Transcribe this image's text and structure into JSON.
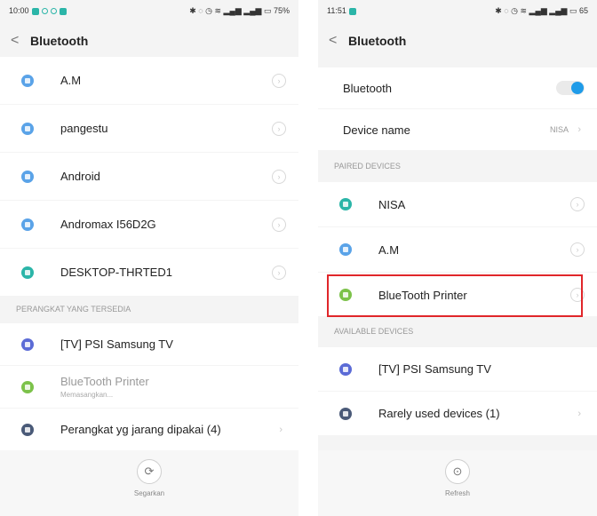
{
  "left": {
    "status": {
      "time": "10:00",
      "battery": "75%"
    },
    "title": "Bluetooth",
    "paired": [
      {
        "label": "A.M",
        "color": "#5aa3e8"
      },
      {
        "label": "pangestu",
        "color": "#5aa3e8"
      },
      {
        "label": "Android",
        "color": "#5aa3e8"
      },
      {
        "label": "Andromax I56D2G",
        "color": "#5aa3e8"
      },
      {
        "label": "DESKTOP-THRTED1",
        "color": "#2bb5a8"
      }
    ],
    "section_available": "PERANGKAT YANG TERSEDIA",
    "available": [
      {
        "label": "[TV] PSI Samsung TV",
        "color": "#5b6bd6"
      },
      {
        "label": "BlueTooth Printer",
        "sub": "Memasangkan...",
        "color": "#7cc24a"
      },
      {
        "label": "Perangkat yg jarang dipakai (4)",
        "color": "#4a5a78"
      }
    ],
    "footer_label": "Segarkan"
  },
  "right": {
    "status": {
      "time": "11:51",
      "battery": "65"
    },
    "title": "Bluetooth",
    "bluetooth_label": "Bluetooth",
    "bluetooth_on": true,
    "device_name_label": "Device name",
    "device_name_value": "NISA",
    "section_paired": "PAIRED DEVICES",
    "paired": [
      {
        "label": "NISA",
        "color": "#2bb5a8"
      },
      {
        "label": "A.M",
        "color": "#5aa3e8"
      },
      {
        "label": "BlueTooth Printer",
        "color": "#7cc24a"
      }
    ],
    "section_available": "AVAILABLE DEVICES",
    "available": [
      {
        "label": "[TV] PSI Samsung TV",
        "color": "#5b6bd6"
      },
      {
        "label": "Rarely used devices (1)",
        "color": "#4a5a78"
      }
    ],
    "footer_label": "Refresh"
  },
  "colors": {
    "accent": "#1f9be8",
    "highlight": "#e0262a"
  }
}
